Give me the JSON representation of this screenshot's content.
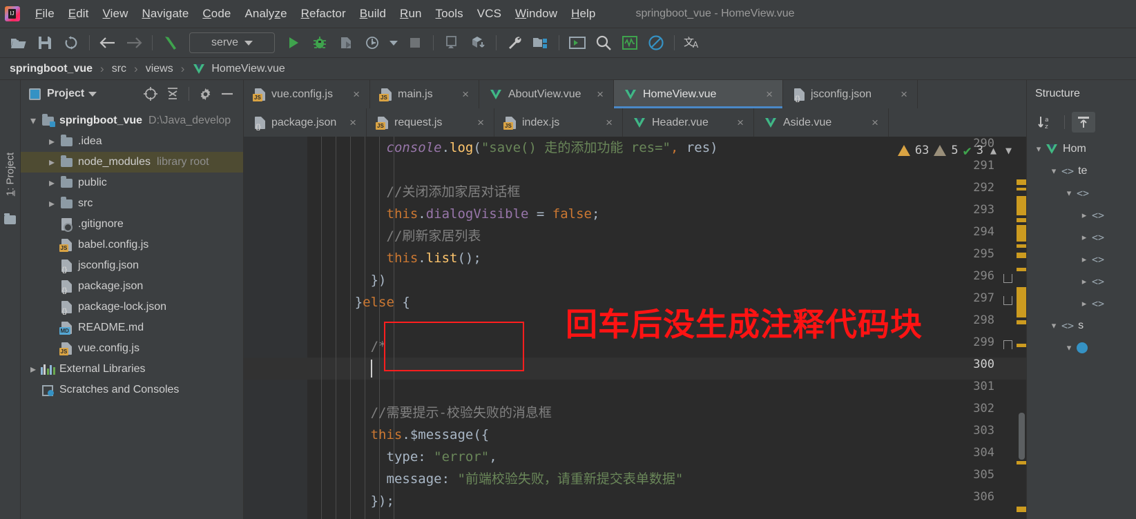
{
  "window": {
    "title": "springboot_vue - HomeView.vue"
  },
  "menubar": {
    "items": [
      {
        "label": "File",
        "mnemonic": "F"
      },
      {
        "label": "Edit",
        "mnemonic": "E"
      },
      {
        "label": "View",
        "mnemonic": "V"
      },
      {
        "label": "Navigate",
        "mnemonic": "N"
      },
      {
        "label": "Code",
        "mnemonic": "C"
      },
      {
        "label": "Analyze",
        "mnemonic": "z"
      },
      {
        "label": "Refactor",
        "mnemonic": "R"
      },
      {
        "label": "Build",
        "mnemonic": "B"
      },
      {
        "label": "Run",
        "mnemonic": "R"
      },
      {
        "label": "Tools",
        "mnemonic": "T"
      },
      {
        "label": "VCS",
        "mnemonic": ""
      },
      {
        "label": "Window",
        "mnemonic": "W"
      },
      {
        "label": "Help",
        "mnemonic": "H"
      }
    ]
  },
  "toolbar": {
    "open_icon": "open-folder-icon",
    "save_icon": "save-icon",
    "sync_icon": "sync-icon",
    "back_icon": "back-arrow-icon",
    "forward_icon": "forward-arrow-icon",
    "build_icon": "build-hammer-icon",
    "run_config": {
      "name": "serve"
    },
    "run_icon": "run-icon",
    "debug_icon": "debug-icon",
    "coverage_icon": "run-with-coverage-icon",
    "profile_icon": "profile-icon",
    "stop_icon": "stop-icon",
    "updateapp_icon": "update-app-icon",
    "deploy_icon": "deploy-icon",
    "settings_icon": "wrench-settings-icon",
    "projstruct_icon": "project-structure-icon",
    "terminal_icon": "terminal-icon",
    "search_icon": "search-everywhere-icon",
    "monitor_icon": "monitor-icon",
    "noaccess_icon": "no-access-icon",
    "translate_icon": "translate-icon"
  },
  "breadcrumb": {
    "parts": [
      "springboot_vue",
      "src",
      "views",
      "HomeView.vue"
    ],
    "separator": "›"
  },
  "left_stripe": {
    "label": "1: Project",
    "mnemonic": "1"
  },
  "project_panel": {
    "title": "Project",
    "icons": [
      "locate-icon",
      "collapse-all-icon",
      "gear-icon",
      "hide-icon"
    ],
    "tree": [
      {
        "label": "springboot_vue",
        "hint": "D:\\Java_develop",
        "icon": "project-folder-icon",
        "depth": 0,
        "arrow": "down",
        "bold": true,
        "selected": false
      },
      {
        "label": ".idea",
        "hint": "",
        "icon": "folder-icon",
        "depth": 1,
        "arrow": "right",
        "bold": false,
        "selected": false
      },
      {
        "label": "node_modules",
        "hint": "library root",
        "icon": "folder-icon",
        "depth": 1,
        "arrow": "right",
        "bold": false,
        "selected": true
      },
      {
        "label": "public",
        "hint": "",
        "icon": "folder-icon",
        "depth": 1,
        "arrow": "right",
        "bold": false,
        "selected": false
      },
      {
        "label": "src",
        "hint": "",
        "icon": "folder-icon",
        "depth": 1,
        "arrow": "right",
        "bold": false,
        "selected": false
      },
      {
        "label": ".gitignore",
        "hint": "",
        "icon": "gitignore-file-icon",
        "depth": 1,
        "arrow": "",
        "bold": false,
        "selected": false
      },
      {
        "label": "babel.config.js",
        "hint": "",
        "icon": "js-file-icon",
        "depth": 1,
        "arrow": "",
        "bold": false,
        "selected": false
      },
      {
        "label": "jsconfig.json",
        "hint": "",
        "icon": "json-file-icon",
        "depth": 1,
        "arrow": "",
        "bold": false,
        "selected": false
      },
      {
        "label": "package.json",
        "hint": "",
        "icon": "json-file-icon",
        "depth": 1,
        "arrow": "",
        "bold": false,
        "selected": false
      },
      {
        "label": "package-lock.json",
        "hint": "",
        "icon": "json-file-icon",
        "depth": 1,
        "arrow": "",
        "bold": false,
        "selected": false
      },
      {
        "label": "README.md",
        "hint": "",
        "icon": "md-file-icon",
        "depth": 1,
        "arrow": "",
        "bold": false,
        "selected": false
      },
      {
        "label": "vue.config.js",
        "hint": "",
        "icon": "js-file-icon",
        "depth": 1,
        "arrow": "",
        "bold": false,
        "selected": false
      },
      {
        "label": "External Libraries",
        "hint": "",
        "icon": "libraries-icon",
        "depth": 0,
        "arrow": "right",
        "bold": false,
        "selected": false
      },
      {
        "label": "Scratches and Consoles",
        "hint": "",
        "icon": "scratches-icon",
        "depth": 0,
        "arrow": "",
        "bold": false,
        "selected": false
      }
    ]
  },
  "editor_tabs": {
    "row1": [
      {
        "label": "vue.config.js",
        "icon": "js-file-icon",
        "active": false,
        "close": "×"
      },
      {
        "label": "main.js",
        "icon": "js-file-icon",
        "active": false,
        "close": "×"
      },
      {
        "label": "AboutView.vue",
        "icon": "vue-file-icon",
        "active": false,
        "close": "×"
      },
      {
        "label": "HomeView.vue",
        "icon": "vue-file-icon",
        "active": true,
        "close": "×"
      },
      {
        "label": "jsconfig.json",
        "icon": "json-file-icon",
        "active": false,
        "close": "×"
      }
    ],
    "row2": [
      {
        "label": "package.json",
        "icon": "json-file-icon",
        "active": false,
        "close": "×"
      },
      {
        "label": "request.js",
        "icon": "js-file-icon",
        "active": false,
        "close": "×"
      },
      {
        "label": "index.js",
        "icon": "js-file-icon",
        "active": false,
        "close": "×"
      },
      {
        "label": "Header.vue",
        "icon": "vue-file-icon",
        "active": false,
        "close": "×"
      },
      {
        "label": "Aside.vue",
        "icon": "vue-file-icon",
        "active": false,
        "close": "×"
      }
    ]
  },
  "editor": {
    "first_line": 290,
    "current_line": 300,
    "line_numbers": [
      290,
      291,
      292,
      293,
      294,
      295,
      296,
      297,
      298,
      299,
      300,
      301,
      302,
      303,
      304,
      305,
      306
    ],
    "lines": [
      {
        "n": 290,
        "indent": 10,
        "tokens": [
          {
            "t": "console",
            "c": "console"
          },
          {
            "t": ".",
            "c": "plain"
          },
          {
            "t": "log",
            "c": "fn"
          },
          {
            "t": "(",
            "c": "plain"
          },
          {
            "t": "\"save() 走的添加功能 res=\"",
            "c": "str"
          },
          {
            "t": ",",
            "c": "kw"
          },
          {
            "t": " res)",
            "c": "plain"
          }
        ]
      },
      {
        "n": 291,
        "indent": 0,
        "tokens": []
      },
      {
        "n": 292,
        "indent": 10,
        "tokens": [
          {
            "t": "//关闭添加家居对话框",
            "c": "cm"
          }
        ]
      },
      {
        "n": 293,
        "indent": 10,
        "tokens": [
          {
            "t": "this",
            "c": "kw"
          },
          {
            "t": ".",
            "c": "plain"
          },
          {
            "t": "dialogVisible",
            "c": "field"
          },
          {
            "t": " = ",
            "c": "plain"
          },
          {
            "t": "false",
            "c": "kw"
          },
          {
            "t": ";",
            "c": "plain"
          }
        ]
      },
      {
        "n": 294,
        "indent": 10,
        "tokens": [
          {
            "t": "//刷新家居列表",
            "c": "cm"
          }
        ]
      },
      {
        "n": 295,
        "indent": 10,
        "tokens": [
          {
            "t": "this",
            "c": "kw"
          },
          {
            "t": ".",
            "c": "plain"
          },
          {
            "t": "list",
            "c": "fn"
          },
          {
            "t": "();",
            "c": "plain"
          }
        ]
      },
      {
        "n": 296,
        "indent": 8,
        "tokens": [
          {
            "t": "})",
            "c": "plain"
          }
        ]
      },
      {
        "n": 297,
        "indent": 6,
        "tokens": [
          {
            "t": "}",
            "c": "plain"
          },
          {
            "t": "else",
            "c": "kw"
          },
          {
            "t": " {",
            "c": "plain"
          }
        ]
      },
      {
        "n": 298,
        "indent": 0,
        "tokens": []
      },
      {
        "n": 299,
        "indent": 8,
        "tokens": [
          {
            "t": "/*",
            "c": "cm"
          }
        ]
      },
      {
        "n": 300,
        "indent": 8,
        "tokens": []
      },
      {
        "n": 301,
        "indent": 0,
        "tokens": []
      },
      {
        "n": 302,
        "indent": 8,
        "tokens": [
          {
            "t": "//需要提示-校验失败的消息框",
            "c": "cm"
          }
        ]
      },
      {
        "n": 303,
        "indent": 8,
        "tokens": [
          {
            "t": "this",
            "c": "kw"
          },
          {
            "t": ".",
            "c": "plain"
          },
          {
            "t": "$message",
            "c": "plain"
          },
          {
            "t": "({",
            "c": "plain"
          }
        ]
      },
      {
        "n": 304,
        "indent": 10,
        "tokens": [
          {
            "t": "type: ",
            "c": "plain"
          },
          {
            "t": "\"error\"",
            "c": "str"
          },
          {
            "t": ",",
            "c": "plain"
          }
        ]
      },
      {
        "n": 305,
        "indent": 10,
        "tokens": [
          {
            "t": "message: ",
            "c": "plain"
          },
          {
            "t": "\"前端校验失败，请重新提交表单数据\"",
            "c": "str"
          }
        ]
      },
      {
        "n": 306,
        "indent": 8,
        "tokens": [
          {
            "t": "});",
            "c": "plain"
          }
        ]
      }
    ],
    "fold_markers": [
      {
        "line": 296,
        "type": "close"
      },
      {
        "line": 297,
        "type": "close"
      },
      {
        "line": 299,
        "type": "open"
      }
    ],
    "inspection": {
      "warnings": "63",
      "weak_warnings": "5",
      "ok_count": "3",
      "up_icon": "prev-highlight-icon",
      "down_icon": "next-highlight-icon"
    },
    "annotation": {
      "text": "回车后没生成注释代码块",
      "box_color": "#ff1e1e",
      "text_color": "#ff1313"
    }
  },
  "structure_panel": {
    "title": "Structure",
    "sort_icon": "sort-alphabetically-icon",
    "expand_icon": "scroll-from-source-icon",
    "nodes": [
      {
        "arrow": "down",
        "icon": "vue-file-icon",
        "label": "Hom",
        "depth": 0
      },
      {
        "arrow": "down",
        "icon": "tag-icon",
        "label": "te",
        "depth": 1
      },
      {
        "arrow": "down",
        "icon": "tag-icon",
        "label": "",
        "depth": 2
      },
      {
        "arrow": "right",
        "icon": "tag-icon",
        "label": "",
        "depth": 3
      },
      {
        "arrow": "right",
        "icon": "tag-icon",
        "label": "",
        "depth": 3
      },
      {
        "arrow": "right",
        "icon": "tag-icon",
        "label": "",
        "depth": 3
      },
      {
        "arrow": "right",
        "icon": "tag-icon",
        "label": "",
        "depth": 3
      },
      {
        "arrow": "right",
        "icon": "tag-icon",
        "label": "",
        "depth": 3
      },
      {
        "arrow": "down",
        "icon": "tag-icon",
        "label": "s",
        "depth": 1
      },
      {
        "arrow": "down",
        "icon": "circle-icon",
        "label": "",
        "depth": 2
      }
    ]
  },
  "colors": {
    "accent": "#4a88c7",
    "warning": "#d9a343",
    "error": "#ff1313",
    "vue_green": "#41b883",
    "editor_bg": "#2b2b2b",
    "panel_bg": "#3c3f41"
  }
}
